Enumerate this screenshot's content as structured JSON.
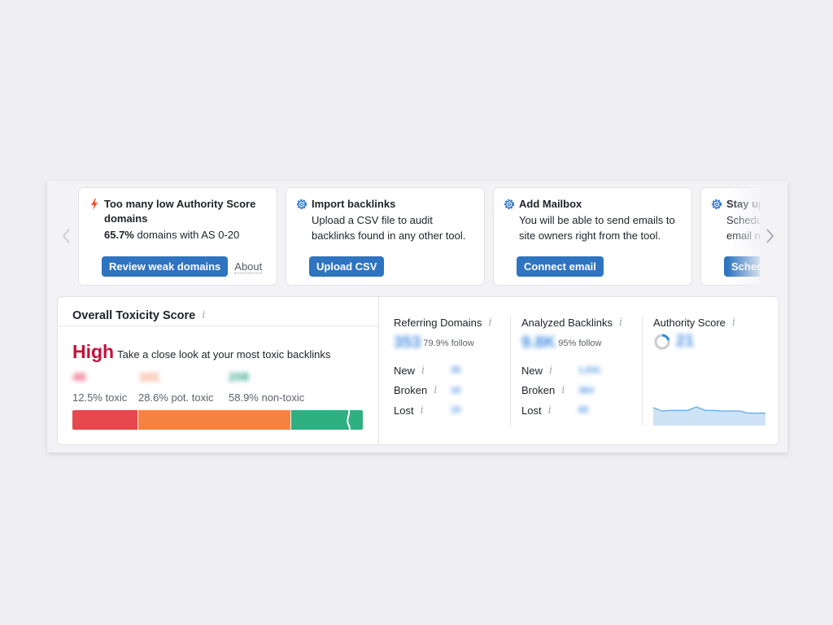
{
  "carousel": {
    "prev_icon": "chevron-left-icon",
    "next_icon": "chevron-right-icon",
    "cards": [
      {
        "icon": "lightning-icon",
        "title": "Too many low Authority Score domains",
        "desc_bold": "65.7%",
        "desc": " domains with AS 0-20",
        "button": "Review weak domains",
        "link": "About"
      },
      {
        "icon": "gear-icon",
        "title": "Import backlinks",
        "desc": "Upload a CSV file to audit backlinks found in any other tool.",
        "button": "Upload CSV"
      },
      {
        "icon": "gear-icon",
        "title": "Add Mailbox",
        "desc": "You will be able to send emails to site owners right from the tool.",
        "button": "Connect email"
      },
      {
        "icon": "gear-icon",
        "title": "Stay up",
        "desc": "Schedu email n",
        "button": "Sched"
      }
    ]
  },
  "toxicity": {
    "title": "Overall Toxicity Score",
    "info": "i",
    "level": "High",
    "level_desc": "Take a close look at your most toxic backlinks",
    "counts": [
      "46",
      "101",
      "208"
    ],
    "labels": [
      "12.5% toxic",
      "28.6% pot. toxic",
      "58.9% non-toxic"
    ],
    "shares": [
      12.5,
      28.6,
      58.9
    ],
    "colors": [
      "#e5484d",
      "#f5833f",
      "#2fb082"
    ],
    "level_color": "#c4113a"
  },
  "referring_domains": {
    "title": "Referring Domains",
    "info": "i",
    "value": "353",
    "follow": "79.9% follow",
    "rows": [
      {
        "label": "New",
        "value": "35"
      },
      {
        "label": "Broken",
        "value": "16"
      },
      {
        "label": "Lost",
        "value": "15"
      }
    ]
  },
  "analyzed_backlinks": {
    "title": "Analyzed Backlinks",
    "info": "i",
    "value": "9.8K",
    "follow": "95% follow",
    "rows": [
      {
        "label": "New",
        "value": "1,041"
      },
      {
        "label": "Broken",
        "value": "364"
      },
      {
        "label": "Lost",
        "value": "65"
      }
    ]
  },
  "authority_score": {
    "title": "Authority Score",
    "info": "i",
    "value": "21",
    "gauge_fraction": 0.21,
    "trend": [
      26,
      21,
      22,
      22,
      22,
      27,
      22,
      22,
      21,
      21,
      21,
      18,
      18,
      18
    ]
  },
  "colors": {
    "accent": "#2f74c0",
    "link_blue": "#4a90e2",
    "chart_fill": "#cfe3f7",
    "chart_line": "#6aaee6"
  }
}
